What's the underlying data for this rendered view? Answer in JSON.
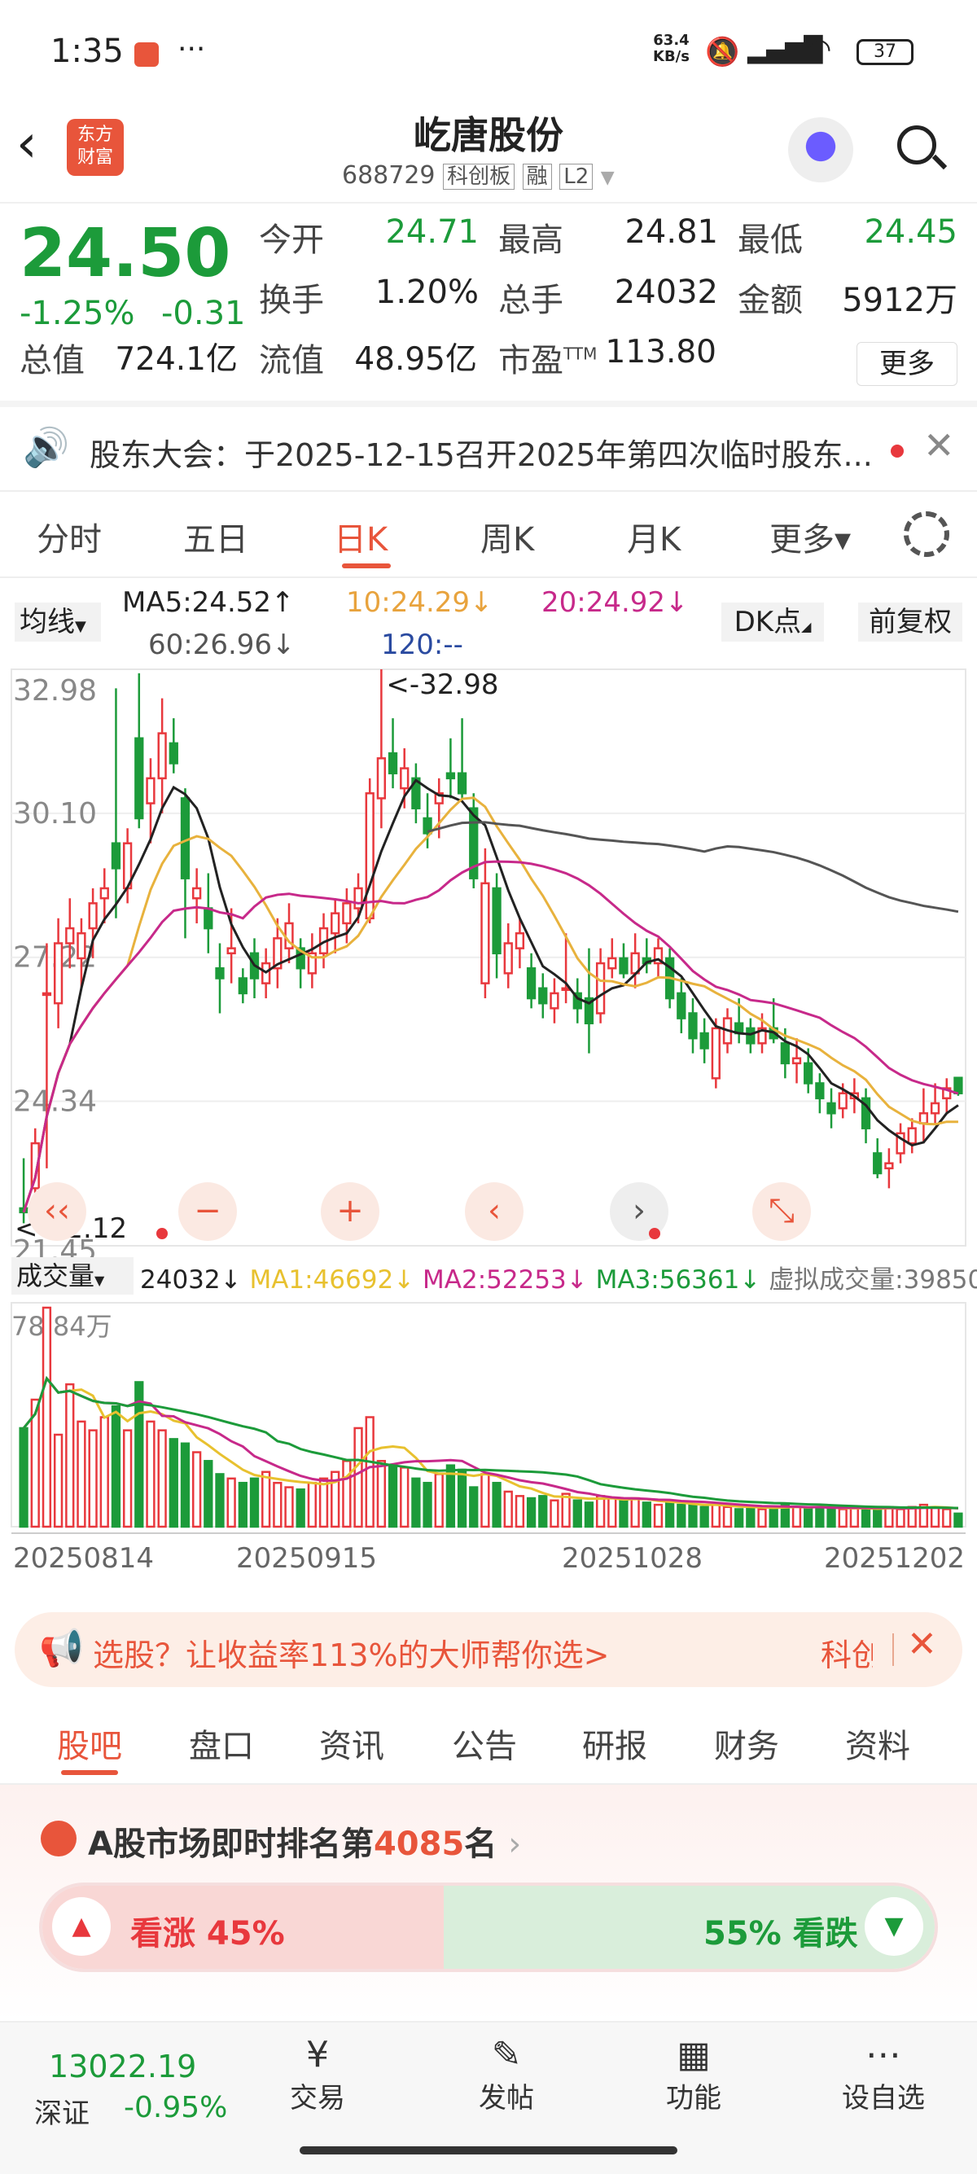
{
  "status_bar": {
    "time": "1:35",
    "dots": "···",
    "net_speed_top": "63.4",
    "net_speed_unit": "KB/s",
    "battery": "37"
  },
  "header": {
    "logo": "东方\n财富",
    "title": "屹唐股份",
    "code": "688729",
    "board": "科创板",
    "margin": "融",
    "level": "L2"
  },
  "quote": {
    "price": "24.50",
    "change_pct": "-1.25%",
    "change": "-0.31",
    "stats": [
      {
        "label": "今开",
        "value": "24.71",
        "color": "grn"
      },
      {
        "label": "最高",
        "value": "24.81",
        "color": "normal"
      },
      {
        "label": "最低",
        "value": "24.45",
        "color": "grn"
      },
      {
        "label": "换手",
        "value": "1.20%",
        "color": "normal"
      },
      {
        "label": "总手",
        "value": "24032",
        "color": "normal"
      },
      {
        "label": "金额",
        "value": "5912万",
        "color": "normal"
      },
      {
        "label": "总值",
        "value": "724.1亿",
        "color": "normal"
      },
      {
        "label": "流值",
        "value": "48.95亿",
        "color": "normal"
      },
      {
        "label": "市盈",
        "sup": "TTM",
        "value": "113.80",
        "color": "normal"
      }
    ],
    "more_button": "更多"
  },
  "notice": {
    "text": "股东大会：于2025-12-15召开2025年第四次临时股东..."
  },
  "period_tabs": [
    "分时",
    "五日",
    "日K",
    "周K",
    "月K",
    "更多"
  ],
  "active_period": "日K",
  "ma_legend": {
    "selector": "均线",
    "ma5": "MA5:24.52↑",
    "ma10": "10:24.29↓",
    "ma20": "20:24.92↓",
    "ma60": "60:26.96↓",
    "ma120": "120:--",
    "dk_button": "DK点",
    "adjust_button": "前复权"
  },
  "price_axis": [
    "32.98",
    "30.10",
    "27.22",
    "24.34",
    "21.45"
  ],
  "price_marks": {
    "high": "<-32.98",
    "low": "<-22.12"
  },
  "volume": {
    "selector": "成交量",
    "value": "24032↓",
    "ma1": "MA1:46692↓",
    "ma2": "MA2:52253↓",
    "ma3": "MA3:56361↓",
    "virtual": "虚拟成交量:39850",
    "max_label": "78.84万"
  },
  "dates": [
    "20250814",
    "20250915",
    "20251028",
    "20251202"
  ],
  "ad": {
    "text": "选股？让收益率113%的大师帮你选>",
    "right": "科创"
  },
  "section_tabs": [
    "股吧",
    "盘口",
    "资讯",
    "公告",
    "研报",
    "财务",
    "资料"
  ],
  "active_section": "股吧",
  "ranking": {
    "prefix": "A股市场即时排名第",
    "rank": "4085",
    "suffix": "名"
  },
  "sentiment": {
    "up_label": "看涨 45%",
    "down_label": "55% 看跌",
    "up_pct": 45
  },
  "bottom": {
    "index_value": "13022.19",
    "index_name": "深证",
    "index_change": "-0.95%",
    "items": [
      "交易",
      "发帖",
      "功能",
      "设自选"
    ]
  },
  "chart_data": {
    "type": "candlestick",
    "ylim": [
      21.45,
      32.98
    ],
    "y_ticks": [
      32.98,
      30.1,
      27.22,
      24.34,
      21.45
    ],
    "x_ticks": [
      "20250814",
      "20250915",
      "20251028",
      "20251202"
    ],
    "candles": [
      [
        22.2,
        23.2,
        21.9,
        22.12
      ],
      [
        22.6,
        23.8,
        22.4,
        23.5
      ],
      [
        26.5,
        27.5,
        23.0,
        26.5
      ],
      [
        26.3,
        28.0,
        25.8,
        27.5
      ],
      [
        27.5,
        28.4,
        27.0,
        27.8
      ],
      [
        27.2,
        28.0,
        26.6,
        27.7
      ],
      [
        27.8,
        28.6,
        27.2,
        28.3
      ],
      [
        28.4,
        29.0,
        27.9,
        28.6
      ],
      [
        29.5,
        32.6,
        28.0,
        29.0
      ],
      [
        28.6,
        29.8,
        28.3,
        29.5
      ],
      [
        31.6,
        32.9,
        29.8,
        30.0
      ],
      [
        30.3,
        31.2,
        29.5,
        30.8
      ],
      [
        30.8,
        32.4,
        30.1,
        31.7
      ],
      [
        31.5,
        32.0,
        30.9,
        31.1
      ],
      [
        30.4,
        30.6,
        27.6,
        28.8
      ],
      [
        28.4,
        29.0,
        27.9,
        28.6
      ],
      [
        28.2,
        28.9,
        27.3,
        27.8
      ],
      [
        27.0,
        27.5,
        26.1,
        26.8
      ],
      [
        27.3,
        28.2,
        26.7,
        27.4
      ],
      [
        26.8,
        27.0,
        26.3,
        26.5
      ],
      [
        27.3,
        27.6,
        26.4,
        26.8
      ],
      [
        26.7,
        27.4,
        26.4,
        27.1
      ],
      [
        27.0,
        28.0,
        26.6,
        27.6
      ],
      [
        27.4,
        28.3,
        27.1,
        27.9
      ],
      [
        27.4,
        27.6,
        26.6,
        27.0
      ],
      [
        26.9,
        27.7,
        26.6,
        27.3
      ],
      [
        27.3,
        28.1,
        27.0,
        27.8
      ],
      [
        27.7,
        28.4,
        27.3,
        28.1
      ],
      [
        27.9,
        28.6,
        27.5,
        28.3
      ],
      [
        28.2,
        28.9,
        27.9,
        28.6
      ],
      [
        28.0,
        30.8,
        27.9,
        30.5
      ],
      [
        30.4,
        32.98,
        29.8,
        31.2
      ],
      [
        31.3,
        32.0,
        30.6,
        30.9
      ],
      [
        30.6,
        31.4,
        30.2,
        31.0
      ],
      [
        30.8,
        31.1,
        29.9,
        30.2
      ],
      [
        30.0,
        30.5,
        29.4,
        29.7
      ],
      [
        30.3,
        30.8,
        29.6,
        30.5
      ],
      [
        30.9,
        31.6,
        30.4,
        30.8
      ],
      [
        30.9,
        32.0,
        30.4,
        30.5
      ],
      [
        30.2,
        30.5,
        28.6,
        28.8
      ],
      [
        26.7,
        29.4,
        26.4,
        28.7
      ],
      [
        28.6,
        28.9,
        26.8,
        27.3
      ],
      [
        26.9,
        27.9,
        26.6,
        27.5
      ],
      [
        27.4,
        28.0,
        27.0,
        27.7
      ],
      [
        27.0,
        27.3,
        26.2,
        26.4
      ],
      [
        26.6,
        26.9,
        26.0,
        26.3
      ],
      [
        26.2,
        26.8,
        25.9,
        26.5
      ],
      [
        26.6,
        27.7,
        26.3,
        26.6
      ],
      [
        26.5,
        26.8,
        25.9,
        26.2
      ],
      [
        26.4,
        27.4,
        25.3,
        25.9
      ],
      [
        26.1,
        27.4,
        25.9,
        27.1
      ],
      [
        27.0,
        27.6,
        26.8,
        27.2
      ],
      [
        27.2,
        27.5,
        26.8,
        26.9
      ],
      [
        26.9,
        27.7,
        26.6,
        27.3
      ],
      [
        27.2,
        27.6,
        26.9,
        27.1
      ],
      [
        27.1,
        27.6,
        26.8,
        27.4
      ],
      [
        27.2,
        27.4,
        26.2,
        26.4
      ],
      [
        26.5,
        26.8,
        25.7,
        26.0
      ],
      [
        26.1,
        26.4,
        25.3,
        25.6
      ],
      [
        25.7,
        26.0,
        25.1,
        25.4
      ],
      [
        24.8,
        26.0,
        24.6,
        25.8
      ],
      [
        25.5,
        26.2,
        25.3,
        26.0
      ],
      [
        25.9,
        26.4,
        25.5,
        25.7
      ],
      [
        25.8,
        26.0,
        25.3,
        25.5
      ],
      [
        25.5,
        26.1,
        25.3,
        25.8
      ],
      [
        25.8,
        26.4,
        25.5,
        25.6
      ],
      [
        25.5,
        25.8,
        24.8,
        25.1
      ],
      [
        25.1,
        25.6,
        24.7,
        25.2
      ],
      [
        25.1,
        25.4,
        24.5,
        24.7
      ],
      [
        24.7,
        24.9,
        24.1,
        24.4
      ],
      [
        24.3,
        24.6,
        23.8,
        24.1
      ],
      [
        24.2,
        24.7,
        24.0,
        24.5
      ],
      [
        24.4,
        24.8,
        24.1,
        24.5
      ],
      [
        24.4,
        24.6,
        23.5,
        23.8
      ],
      [
        23.3,
        23.6,
        22.8,
        22.9
      ],
      [
        23.0,
        23.4,
        22.6,
        23.1
      ],
      [
        23.3,
        23.9,
        23.1,
        23.7
      ],
      [
        23.5,
        24.0,
        23.3,
        23.8
      ],
      [
        23.9,
        24.6,
        23.5,
        24.1
      ],
      [
        24.1,
        24.7,
        23.9,
        24.3
      ],
      [
        24.4,
        24.8,
        24.1,
        24.6
      ],
      [
        24.81,
        24.81,
        24.45,
        24.5
      ]
    ],
    "volume_max": "78.84万",
    "volume_levels": [
      0.45,
      0.58,
      1.0,
      0.42,
      0.65,
      0.48,
      0.44,
      0.5,
      0.55,
      0.44,
      0.66,
      0.48,
      0.44,
      0.4,
      0.38,
      0.34,
      0.3,
      0.24,
      0.22,
      0.2,
      0.22,
      0.25,
      0.2,
      0.18,
      0.17,
      0.2,
      0.22,
      0.25,
      0.3,
      0.45,
      0.5,
      0.3,
      0.28,
      0.27,
      0.22,
      0.2,
      0.24,
      0.28,
      0.26,
      0.18,
      0.24,
      0.2,
      0.16,
      0.14,
      0.13,
      0.14,
      0.12,
      0.15,
      0.12,
      0.11,
      0.14,
      0.13,
      0.12,
      0.13,
      0.11,
      0.1,
      0.11,
      0.1,
      0.1,
      0.09,
      0.1,
      0.09,
      0.08,
      0.09,
      0.08,
      0.09,
      0.1,
      0.09,
      0.08,
      0.09,
      0.08,
      0.08,
      0.09,
      0.08,
      0.08,
      0.09,
      0.08,
      0.09,
      0.1,
      0.09,
      0.08,
      0.06
    ]
  }
}
